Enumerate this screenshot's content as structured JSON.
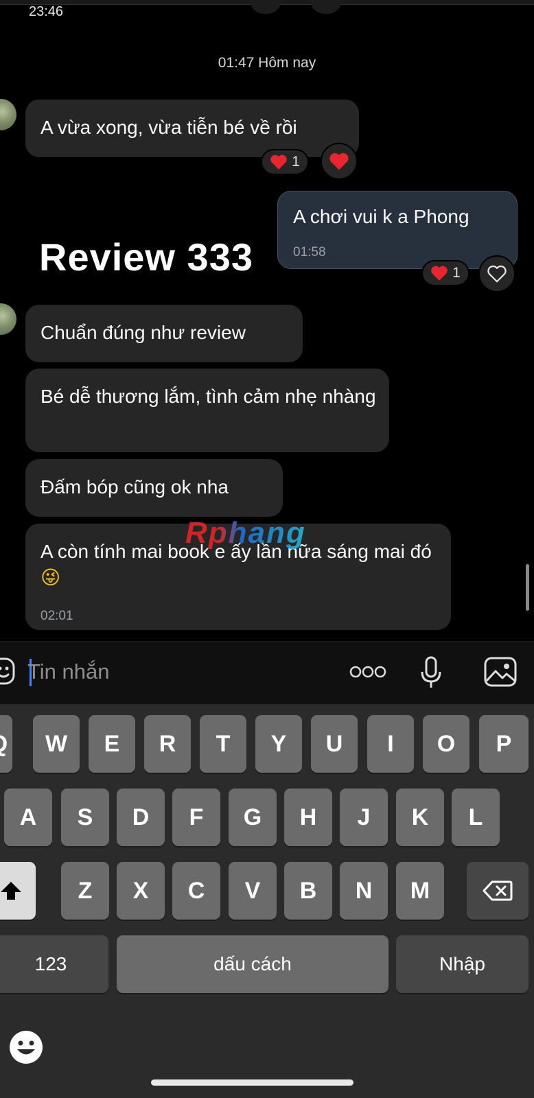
{
  "status_bar": {
    "time": "23:46"
  },
  "chat": {
    "date_separator": "01:47 Hôm nay",
    "messages": [
      {
        "id": "m1",
        "direction": "in",
        "text": "A vừa xong, vừa tiễn bé về rồi",
        "reaction_count": "1"
      },
      {
        "id": "m2",
        "direction": "out",
        "text": "A chơi vui k a Phong",
        "time": "01:58",
        "reaction_count": "1"
      },
      {
        "id": "m3",
        "direction": "in",
        "text": "Chuẩn đúng như review"
      },
      {
        "id": "m4",
        "direction": "in",
        "text": "Bé dễ thương lắm, tình cảm nhẹ nhàng"
      },
      {
        "id": "m5",
        "direction": "in",
        "text": "Đấm bóp cũng ok nha"
      },
      {
        "id": "m6",
        "direction": "in",
        "text": "A còn tính mai book e ấy lần nữa sáng mai đó",
        "emoji": "😜",
        "time": "02:01"
      }
    ]
  },
  "overlay": {
    "title": "Review 333",
    "watermark": "Rphang"
  },
  "composer": {
    "placeholder": "Tin nhắn",
    "more_icon": "more-dots-icon",
    "mic_icon": "microphone-icon",
    "image_icon": "image-icon",
    "sticker_icon": "sticker-icon"
  },
  "keyboard": {
    "row1": [
      "Q",
      "W",
      "E",
      "R",
      "T",
      "Y",
      "U",
      "I",
      "O",
      "P"
    ],
    "row2": [
      "A",
      "S",
      "D",
      "F",
      "G",
      "H",
      "J",
      "K",
      "L"
    ],
    "row3": [
      "Z",
      "X",
      "C",
      "V",
      "B",
      "N",
      "M"
    ],
    "numbers_label": "123",
    "space_label": "dấu cách",
    "return_label": "Nhập",
    "shift_icon": "shift-icon",
    "delete_icon": "backspace-icon",
    "emoji_icon": "emoji-icon"
  },
  "colors": {
    "background": "#000000",
    "bubble_in": "#262626",
    "bubble_out": "#27313e",
    "heart": "#e8262f"
  }
}
